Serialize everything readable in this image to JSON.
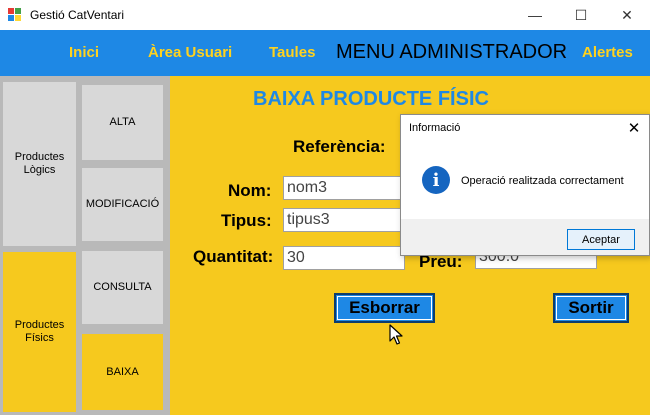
{
  "window": {
    "title": "Gestió CatVentari",
    "minimize_glyph": "—",
    "maximize_glyph": "☐",
    "close_glyph": "✕"
  },
  "menu": {
    "inici": "Inici",
    "area_usuari": "Àrea Usuari",
    "taules": "Taules",
    "title": "MENU ADMINISTRADOR",
    "alertes": "Alertes"
  },
  "sidebar": {
    "productes_logics": "Productes Lògics",
    "productes_fisics": "Productes Físics",
    "alta": "ALTA",
    "modificacio": "MODIFICACIÓ",
    "consulta": "CONSULTA",
    "baixa": "BAIXA"
  },
  "form": {
    "title": "BAIXA PRODUCTE FÍSIC",
    "referencia_label": "Referència:",
    "nom_label": "Nom:",
    "nom_value": "nom3",
    "tipus_label": "Tipus:",
    "tipus_value": "tipus3",
    "quantitat_label": "Quantitat:",
    "quantitat_value": "30",
    "preu_label": "Preu:",
    "preu_value": "300.0",
    "esborrar_button": "Esborrar",
    "sortir_button": "Sortir"
  },
  "dialog": {
    "title": "Informació",
    "close_glyph": "✕",
    "icon_glyph": "i",
    "message": "Operació realitzada correctament",
    "ok_button": "Aceptar"
  },
  "colors": {
    "menu_blue": "#1e88e5",
    "accent_yellow": "#f6c91e",
    "sidebar_gray": "#d8d8d8"
  }
}
